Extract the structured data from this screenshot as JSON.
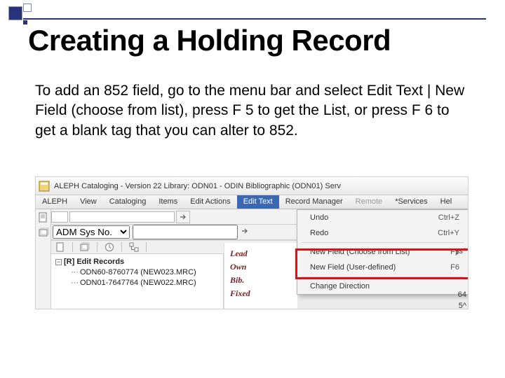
{
  "slide": {
    "title": "Creating a Holding Record",
    "body": "To add an 852 field, go to the menu bar and select Edit Text | New Field (choose from list), press F 5 to get the List, or press F 6 to get a blank tag that you can alter to 852."
  },
  "window": {
    "title": "ALEPH Cataloging - Version 22  Library: ODN01 - ODIN Bibliographic (ODN01)  Serv"
  },
  "menubar": {
    "items": [
      "ALEPH",
      "View",
      "Cataloging",
      "Items",
      "Edit Actions",
      "Edit Text",
      "Record Manager",
      "Remote",
      "*Services",
      "Hel"
    ],
    "open_index": 5,
    "disabled_index": 7
  },
  "search": {
    "placeholder": "",
    "sysno_label": "ADM Sys No."
  },
  "tree": {
    "root": "[R] Edit Records",
    "children": [
      "ODN60-8760774 (NEW023.MRC)",
      "ODN01-7647764 (NEW022.MRC)"
    ]
  },
  "field_labels": [
    "Lead",
    "Own",
    "Bib.",
    "Fixed"
  ],
  "dropdown": {
    "items": [
      {
        "label": "Undo",
        "shortcut": "Ctrl+Z"
      },
      {
        "label": "Redo",
        "shortcut": "Ctrl+Y"
      },
      {
        "sep": true
      },
      {
        "label": "New Field (Choose from List)",
        "shortcut": "F5"
      },
      {
        "label": "New Field (User-defined)",
        "shortcut": "F6"
      },
      {
        "sep": true
      },
      {
        "label": "Change Direction",
        "shortcut": ""
      }
    ]
  },
  "right_gutter": [
    "ys^",
    "",
    "",
    "64",
    "5^"
  ]
}
